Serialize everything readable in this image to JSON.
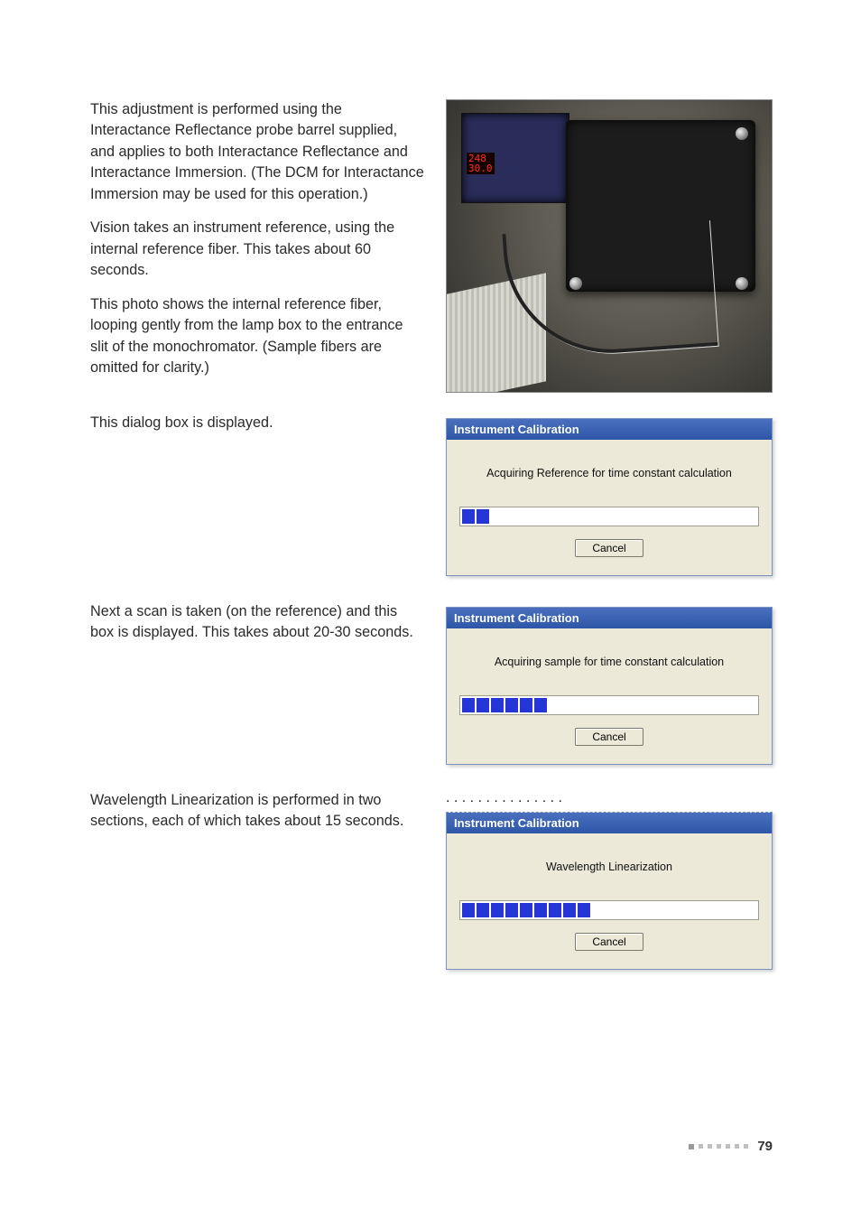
{
  "body": {
    "para1": "This adjustment is performed using the Interactance Reflectance probe barrel supplied, and applies to both Interactance Reflectance and Interactance Immersion. (The DCM for Interactance Immersion may be used for this operation.)",
    "para2": "Vision takes an instrument reference, using the internal reference fiber. This takes about 60 seconds.",
    "para3": "This photo shows the internal reference fiber, looping gently from the lamp box to the entrance slit of the monochromator. (Sample fibers are omitted for clarity.)",
    "para4": "This dialog box is displayed.",
    "para5": "Next a scan is taken (on the reference) and this box is displayed. This takes about 20-30 seconds.",
    "para6": "Wavelength Linearization is performed in two sections, each of which takes about 15 seconds."
  },
  "photo": {
    "led_line1": "248",
    "led_line2": "30.0"
  },
  "dialogs": {
    "d1": {
      "title": "Instrument Calibration",
      "message": "Acquiring Reference for time constant calculation",
      "cancel": "Cancel",
      "segments": 2
    },
    "d2": {
      "title": "Instrument Calibration",
      "message": "Acquiring sample for time constant calculation",
      "cancel": "Cancel",
      "segments": 6
    },
    "d3": {
      "title": "Instrument Calibration",
      "message": "Wavelength Linearization",
      "cancel": "Cancel",
      "segments": 9
    }
  },
  "footer": {
    "page": "79"
  }
}
